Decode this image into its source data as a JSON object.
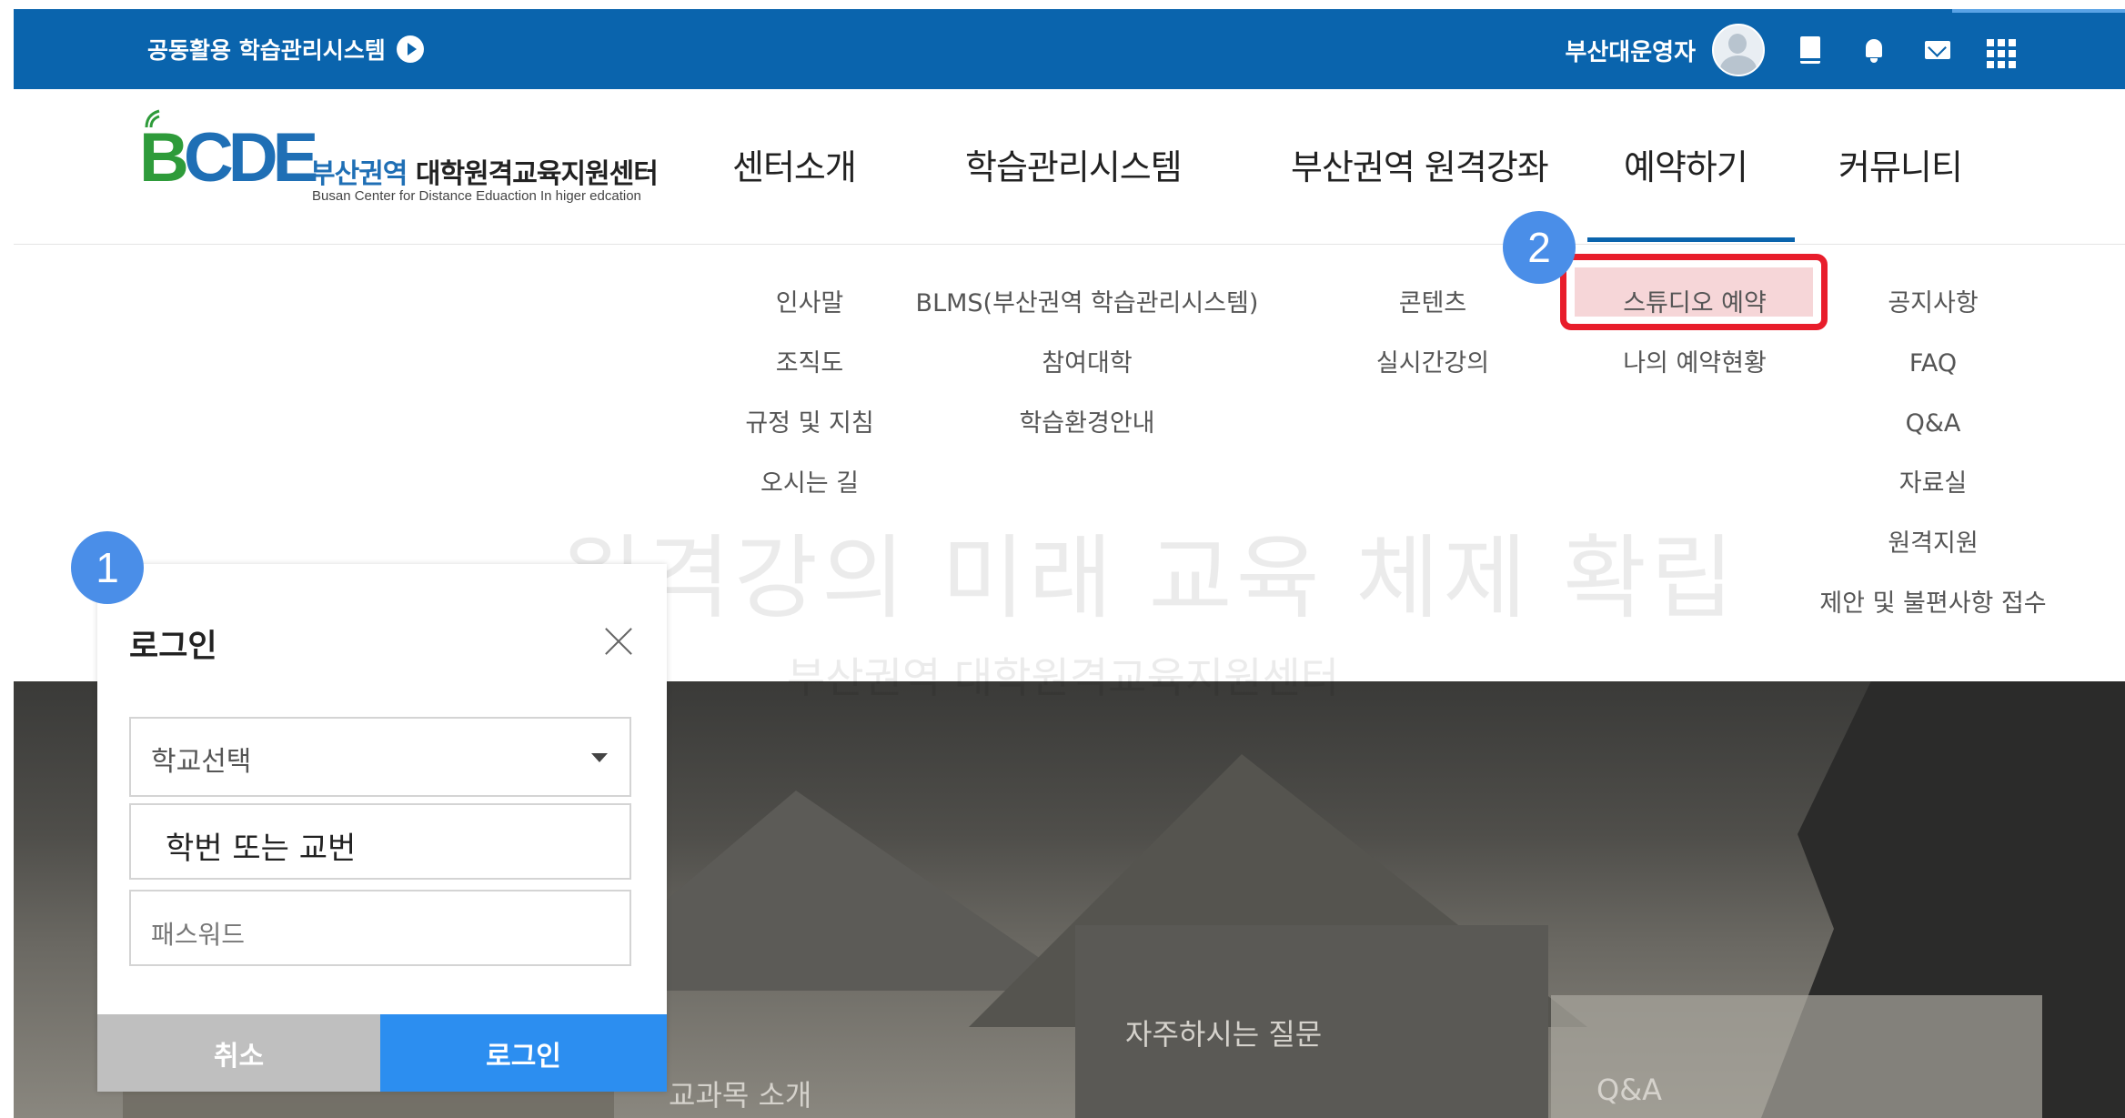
{
  "topbar": {
    "site_link": "공동활용 학습관리시스템",
    "user_name": "부산대운영자"
  },
  "logo": {
    "mark": {
      "b": "B",
      "c": "C",
      "d": "D",
      "e": "E"
    },
    "title_blue": "부산권역",
    "title_rest": "대학원격교육지원센터",
    "subtitle": "Busan Center for Distance Eduaction In higer edcation"
  },
  "gnb": {
    "items": [
      "센터소개",
      "학습관리시스템",
      "부산권역 원격강좌",
      "예약하기",
      "커뮤니티"
    ]
  },
  "submenu": {
    "col1": [
      "인사말",
      "조직도",
      "규정 및 지침",
      "오시는 길"
    ],
    "col2": [
      "BLMS(부산권역 학습관리시스템)",
      "참여대학",
      "학습환경안내"
    ],
    "col3": [
      "콘텐츠",
      "실시간강의"
    ],
    "col4": [
      "스튜디오 예약",
      "나의 예약현황"
    ],
    "col5": [
      "공지사항",
      "FAQ",
      "Q&A",
      "자료실",
      "원격지원",
      "제안 및 불편사항 접수"
    ]
  },
  "hero": {
    "headline": "원격강의 미래 교육 체제 확립",
    "subline": "부산권역 대학원격교육지원센터",
    "cards": [
      "교과목 소개",
      "자주하시는 질문",
      "Q&A"
    ]
  },
  "badges": [
    "1",
    "2"
  ],
  "login": {
    "title": "로그인",
    "school_select": "학교선택",
    "id_value": "학번 또는 교번",
    "pw_placeholder": "패스워드",
    "cancel": "취소",
    "submit": "로그인"
  },
  "colors": {
    "topbar": "#0a64ad",
    "highlight_border": "#e81d2b",
    "badge": "#4a8ee8",
    "login_button": "#2c8ef0"
  }
}
